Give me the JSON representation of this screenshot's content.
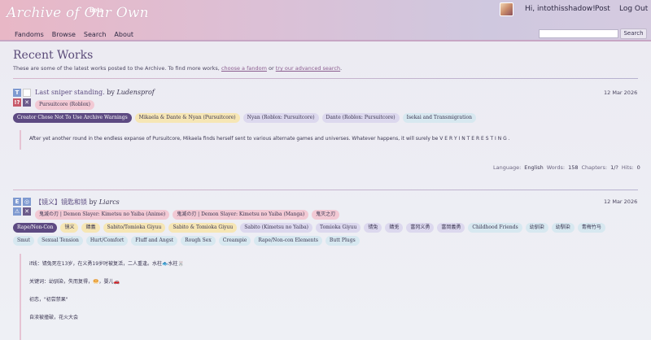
{
  "header": {
    "logo": "Archive of Our Own",
    "beta": "beta",
    "greeting": "Hi, intothisshadow!",
    "post": "Post",
    "logout": "Log Out",
    "nav": [
      "Fandoms",
      "Browse",
      "Search",
      "About"
    ],
    "search_button": "Search",
    "search_value": ""
  },
  "page": {
    "title": "Recent Works",
    "intro_prefix": "These are some of the latest works posted to the Archive. To find more works,",
    "intro_link1": "choose a fandom",
    "intro_mid": "or",
    "intro_link2": "try our advanced search",
    "intro_end": "."
  },
  "works": [
    {
      "title": "Last sniper standing.",
      "by": "by",
      "author": "Ludensprof",
      "date": "12 Mar 2026",
      "req": [
        "T",
        "",
        "!?",
        "✕"
      ],
      "fandoms": [
        "Pursuitcore (Roblox)"
      ],
      "warnings": [
        "Creator Chose Not To Use Archive Warnings"
      ],
      "relationships": [
        "Mikaela & Dante & Nyan (Pursuitcore)"
      ],
      "characters": [
        "Nyan (Roblox: Pursuitcore)",
        "Dante (Roblox: Pursuitcore)"
      ],
      "freeforms": [
        "Isekai and Transmigration"
      ],
      "summary": "After yet another round in the endless expanse of Pursuitcore, Mikaela finds herself sent to various alternate games and universes. Whatever happens, it will surely be V E R Y I N T E R E S T I N G .",
      "stats": {
        "language_label": "Language:",
        "language": "English",
        "words_label": "Words:",
        "words": "158",
        "chapters_label": "Chapters:",
        "chapters": "1/?",
        "hits_label": "Hits:",
        "hits": "0"
      }
    },
    {
      "title": "【镜义】镜匙和锁",
      "by": "by",
      "author": "Liarcs",
      "date": "12 Mar 2026",
      "req": [
        "E",
        "◎",
        "⚠",
        "✕"
      ],
      "fandoms": [
        "鬼滅の刃 | Demon Slayer: Kimetsu no Yaiba (Anime)",
        "鬼滅の刃 | Demon Slayer: Kimetsu no Yaiba (Manga)",
        "鬼灭之刃"
      ],
      "warnings": [
        "Rape/Non-Con"
      ],
      "relationships": [
        "镜义",
        "錆義",
        "Sabito/Tomioka Giyuu",
        "Sabito & Tomioka Giyuu"
      ],
      "characters": [
        "Sabito (Kimetsu no Yaiba)",
        "Tomioka Giyuu",
        "锖兔",
        "錆兎",
        "富冈义勇",
        "富岡義勇"
      ],
      "freeforms": [
        "Childhood Friends",
        "幼驯染",
        "幼馴染",
        "青梅竹马",
        "Smut",
        "Sexual Tension",
        "Hurt/Comfort",
        "Fluff and Angst",
        "Rough Sex",
        "Creampie",
        "Rape/Non-con Elements",
        "Butt Plugs"
      ],
      "summary_lines": [
        "if线：锖兔死在13岁，在义勇19岁时被复活，二人重逢。水柱🐟水柱🐰",
        "关键词：幼驯染，失而复得，🥯，婴儿🚗",
        "初恋，\"初尝禁果\"",
        "自渎被撞破，花火大会"
      ]
    }
  ],
  "colors": {
    "header_gradient_start": "#e8b7c6",
    "header_gradient_end": "#d5cbe0",
    "title": "#5a4a78",
    "fandom_tag": "#f2c9d4",
    "warning_tag": "#5d4a82",
    "relationship_tag": "#f6e6b5",
    "character_tag": "#dcd8ee",
    "freeform_tag": "#d7e8f0"
  }
}
